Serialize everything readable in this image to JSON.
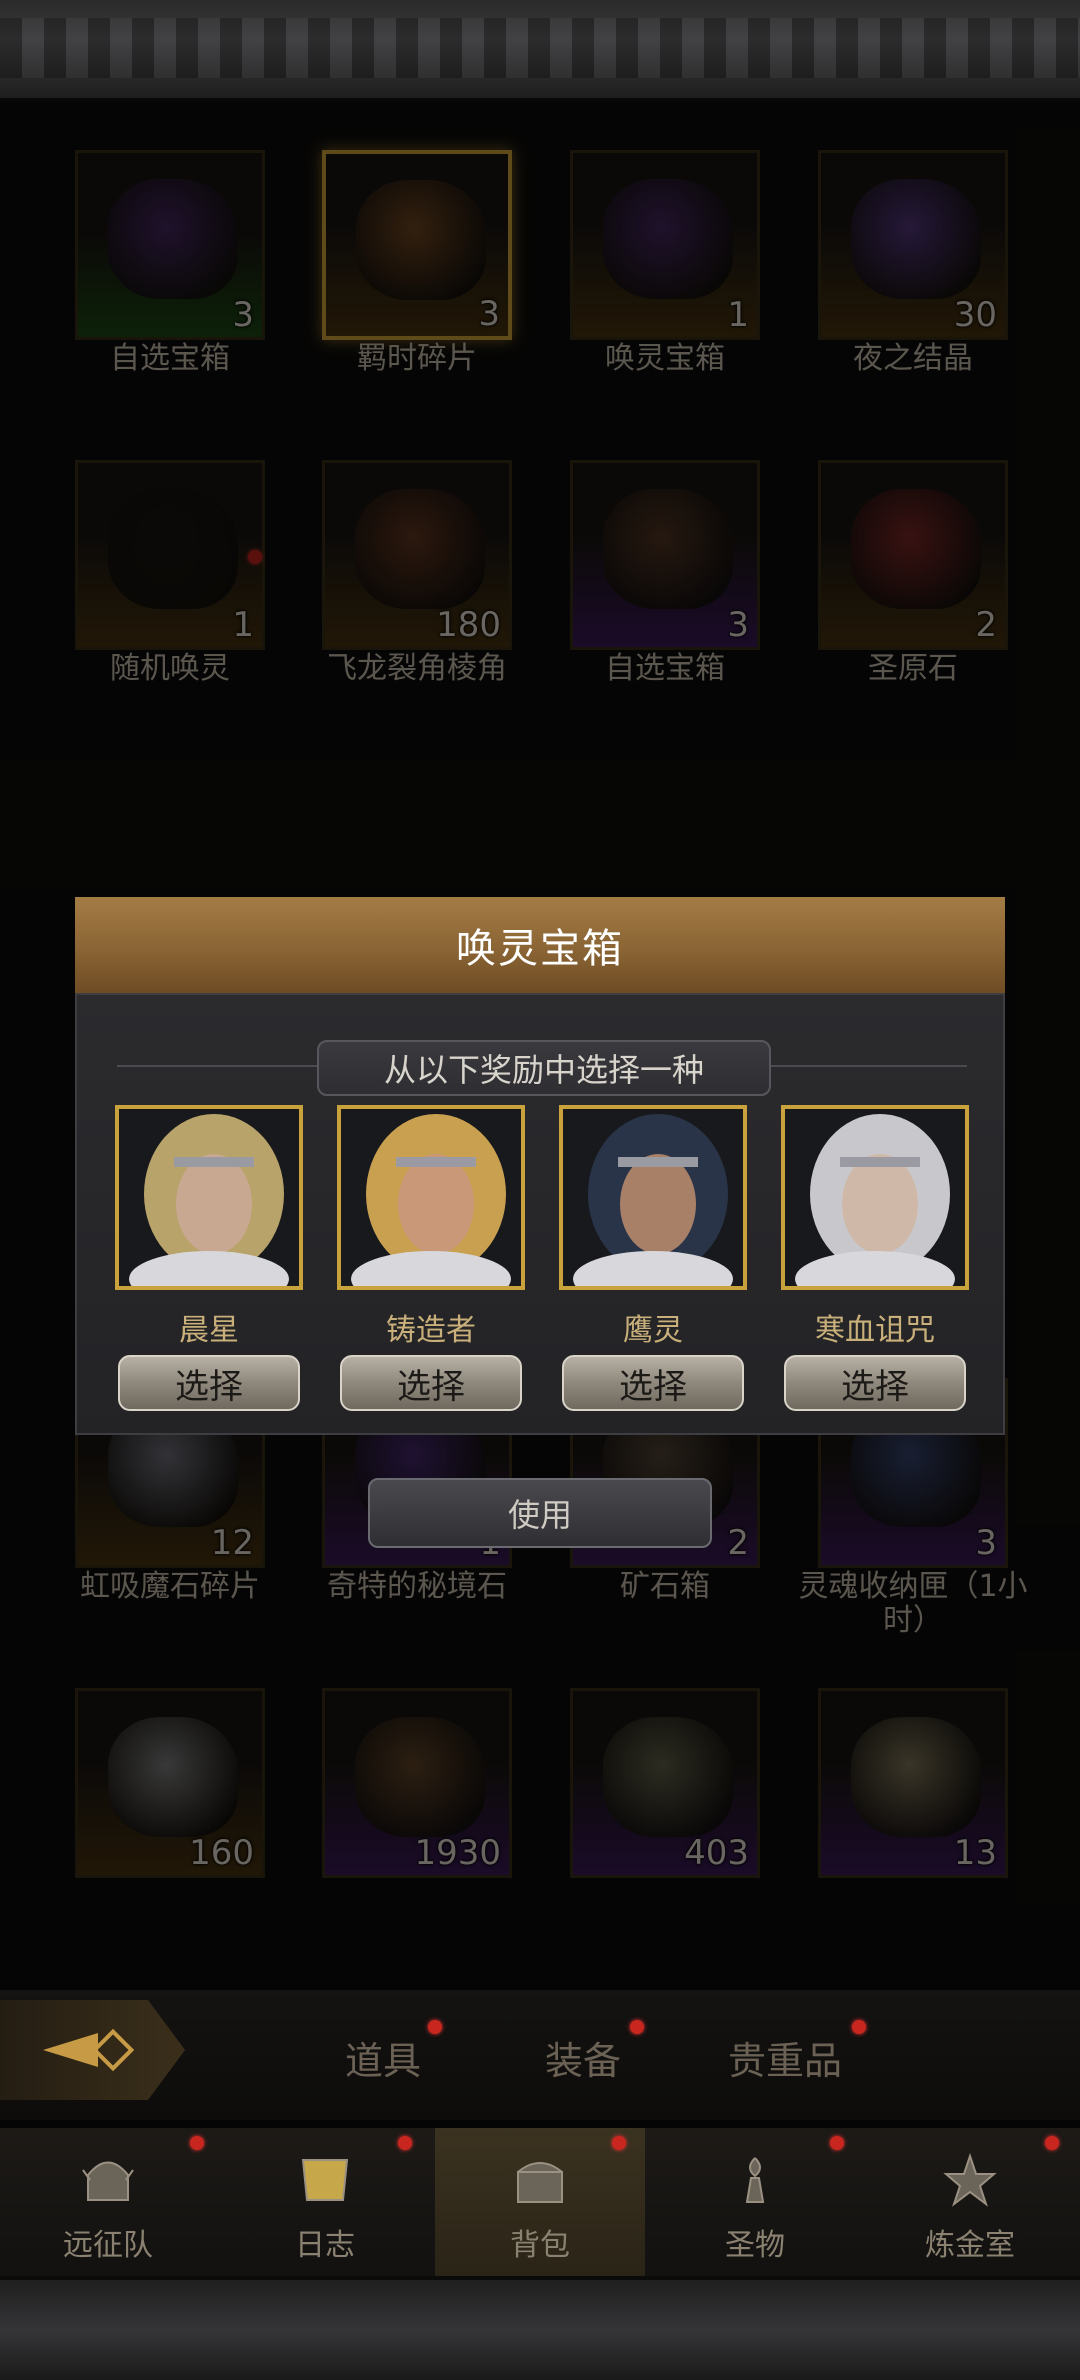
{
  "grid": {
    "rows": [
      [
        {
          "label": "自选宝箱",
          "count": "3",
          "quality": "q-green",
          "art": "#4a2a6a"
        },
        {
          "label": "羁时碎片",
          "count": "3",
          "quality": "q-gold",
          "art": "#7a4c22",
          "selected": true
        },
        {
          "label": "唤灵宝箱",
          "count": "1",
          "quality": "q-gold",
          "art": "#4a2a6a"
        },
        {
          "label": "夜之结晶",
          "count": "30",
          "quality": "q-gold",
          "art": "#5a3a8a"
        }
      ],
      [
        {
          "label": "随机唤灵",
          "count": "1",
          "quality": "q-gold",
          "art": "#1a1612"
        },
        {
          "label": "飞龙裂角棱角",
          "count": "180",
          "quality": "q-gold",
          "art": "#6a3a22"
        },
        {
          "label": "自选宝箱",
          "count": "3",
          "quality": "q-purple",
          "art": "#5a3a26"
        },
        {
          "label": "圣原石",
          "count": "2",
          "quality": "q-gold",
          "art": "#8a2a2a"
        }
      ],
      [
        {
          "label": "虹吸魔石碎片",
          "count": "12",
          "quality": "q-gold",
          "art": "#7a7a86"
        },
        {
          "label": "奇特的秘境石",
          "count": "1",
          "quality": "q-purple",
          "art": "#4a2a7a"
        },
        {
          "label": "矿石箱",
          "count": "2",
          "quality": "q-purple",
          "art": "#5a4a3a"
        },
        {
          "label": "灵魂收纳匣（1小时）",
          "count": "3",
          "quality": "q-purple",
          "art": "#3a4a7a",
          "top_badge": "1小时"
        }
      ],
      [
        {
          "label": "",
          "count": "160",
          "quality": "q-gold",
          "art": "#8a8a8a"
        },
        {
          "label": "",
          "count": "1930",
          "quality": "q-purple",
          "art": "#6a4a2a"
        },
        {
          "label": "",
          "count": "403",
          "quality": "q-purple",
          "art": "#6a6a50"
        },
        {
          "label": "",
          "count": "13",
          "quality": "q-purple",
          "art": "#8a8060"
        }
      ]
    ]
  },
  "modal": {
    "title": "唤灵宝箱",
    "subtitle": "从以下奖励中选择一种",
    "choices": [
      {
        "name": "晨星",
        "button": "选择",
        "hair": "#b8a36a",
        "skin": "#c8a890"
      },
      {
        "name": "铸造者",
        "button": "选择",
        "hair": "#c8a050",
        "skin": "#c89878"
      },
      {
        "name": "鹰灵",
        "button": "选择",
        "hair": "#2a3448",
        "skin": "#a88068"
      },
      {
        "name": "寒血诅咒",
        "button": "选择",
        "hair": "#c8c8cc",
        "skin": "#d0b8a8"
      }
    ],
    "use_button": "使用"
  },
  "category_tabs": [
    {
      "label": "道具"
    },
    {
      "label": "装备"
    },
    {
      "label": "贵重品"
    }
  ],
  "nav": [
    {
      "label": "远征队",
      "icon": "helmet-icon"
    },
    {
      "label": "日志",
      "icon": "scroll-icon"
    },
    {
      "label": "背包",
      "icon": "chest-icon",
      "active": true
    },
    {
      "label": "圣物",
      "icon": "torch-icon"
    },
    {
      "label": "炼金室",
      "icon": "alchemy-icon"
    }
  ],
  "colors": {
    "accent_gold": "#c9a23c",
    "header_bronze": "#8a6434",
    "notification_red": "#c8261e"
  }
}
